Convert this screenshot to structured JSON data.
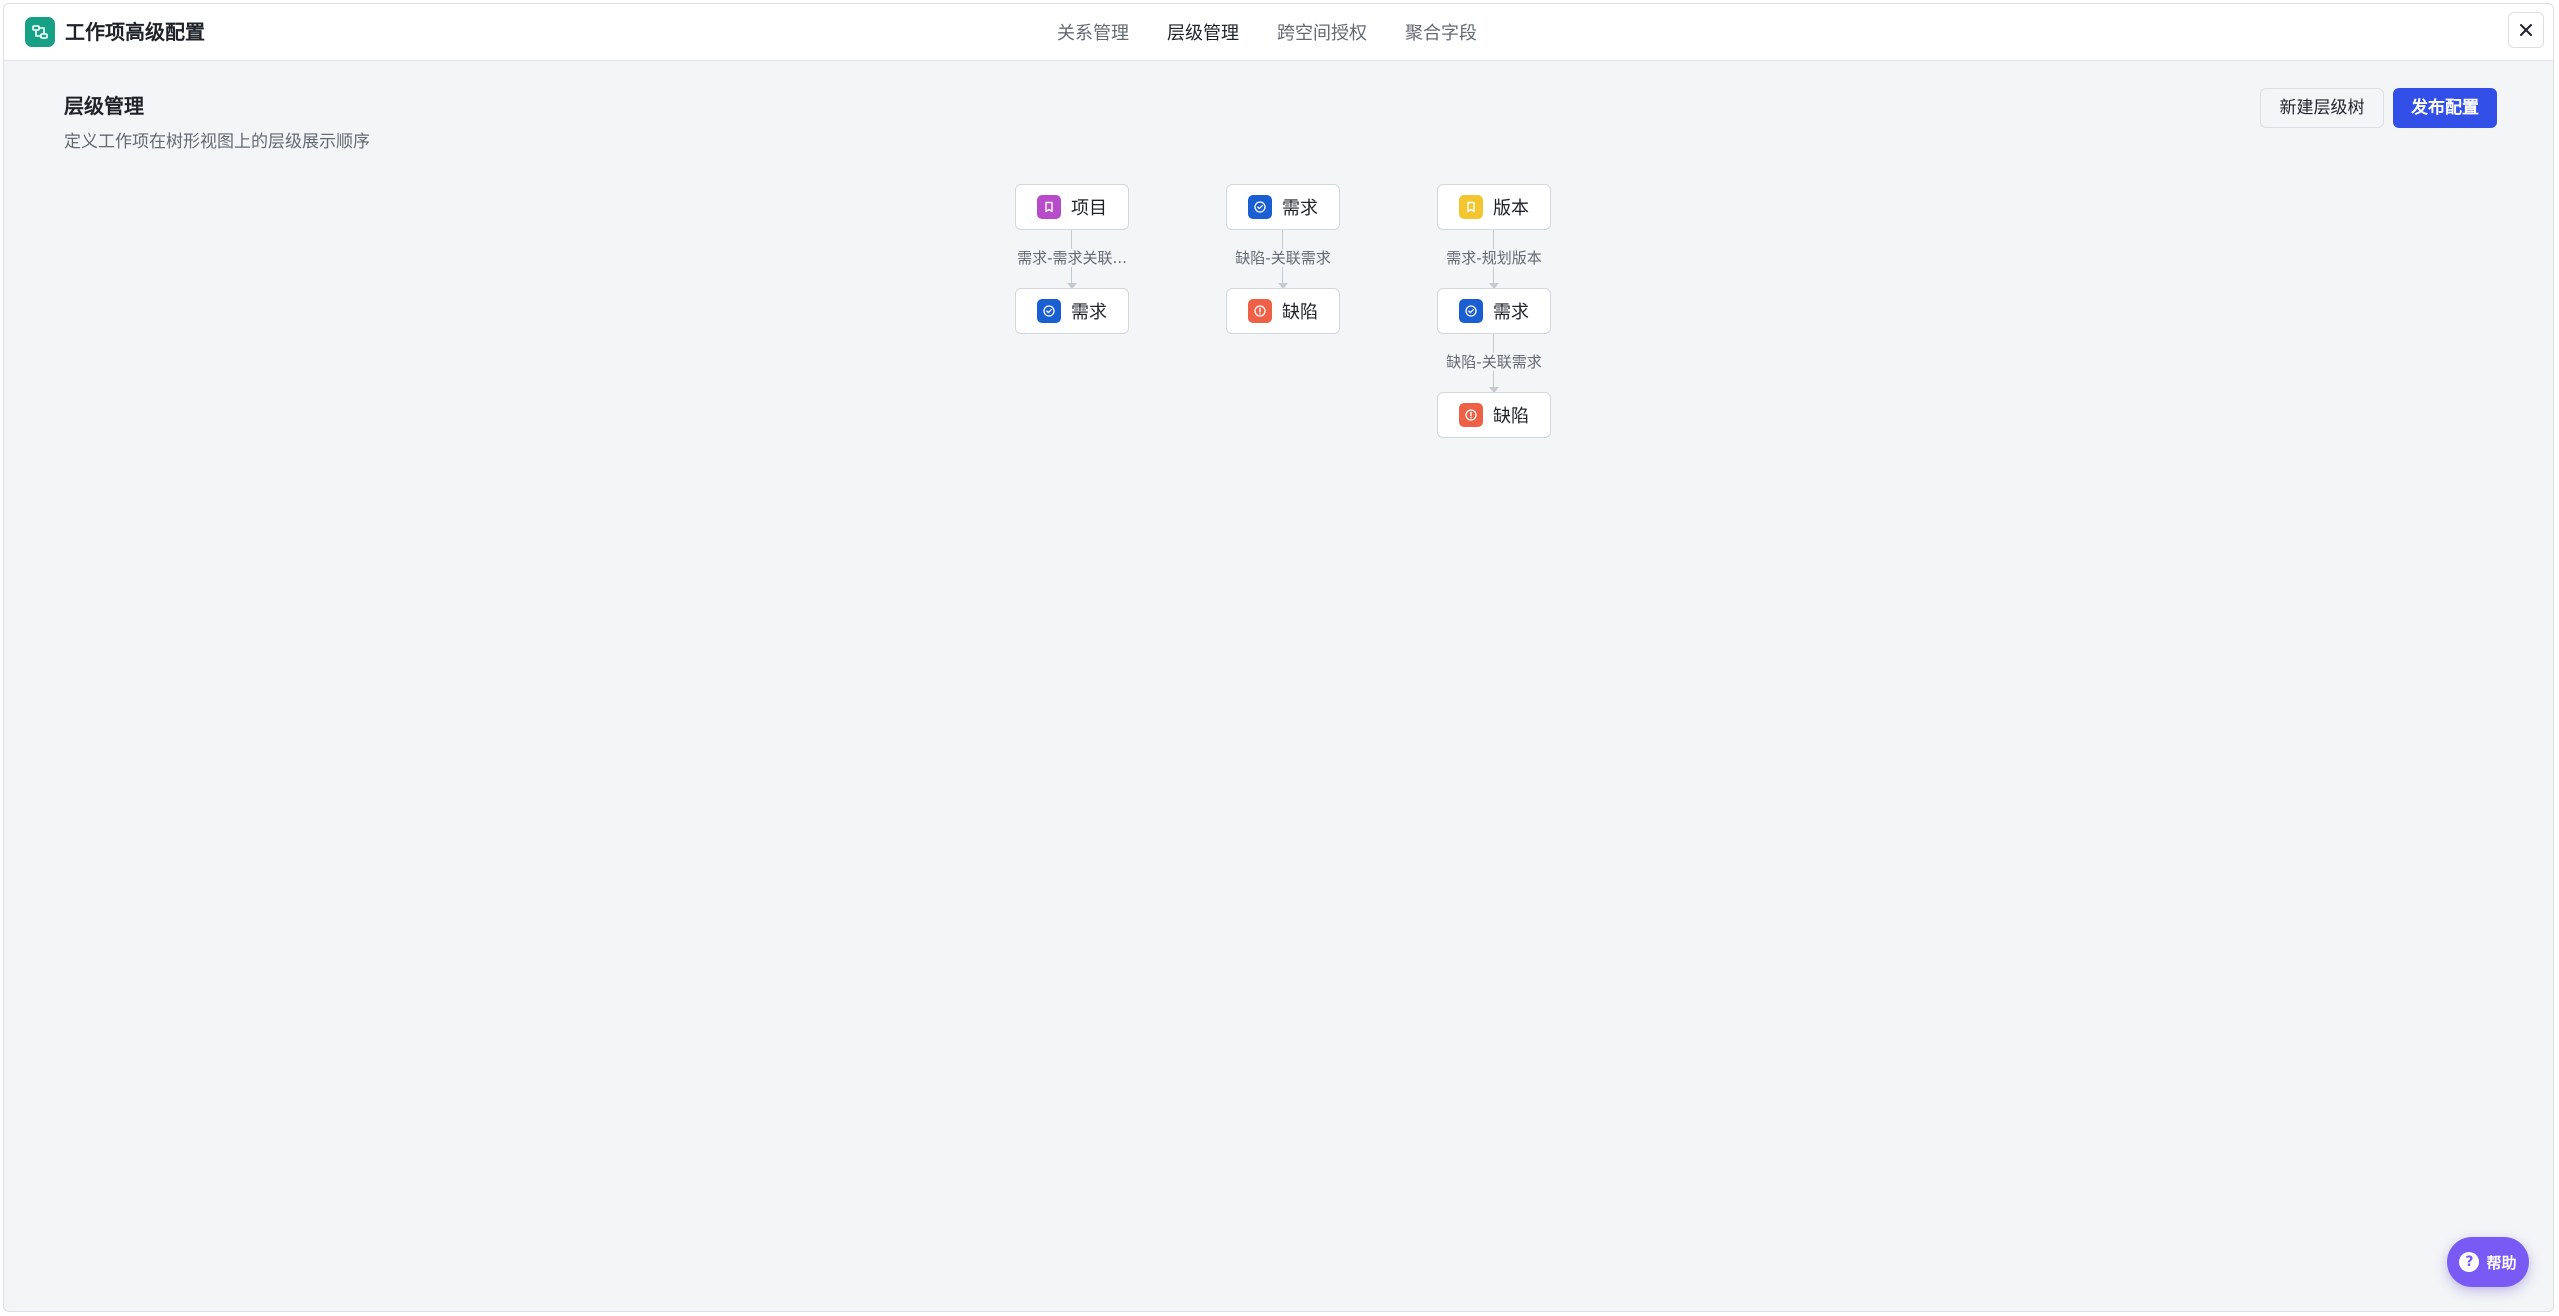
{
  "app": {
    "title": "工作项高级配置",
    "logo_icon": "workflow-icon",
    "close_icon": "close-icon"
  },
  "tabs": [
    {
      "label": "关系管理",
      "active": false
    },
    {
      "label": "层级管理",
      "active": true
    },
    {
      "label": "跨空间授权",
      "active": false
    },
    {
      "label": "聚合字段",
      "active": false
    }
  ],
  "section": {
    "title": "层级管理",
    "description": "定义工作项在树形视图上的层级展示顺序"
  },
  "actions": {
    "new_tree_label": "新建层级树",
    "publish_label": "发布配置"
  },
  "colors": {
    "accent": "#3250e8",
    "logo": "#16a085",
    "project": "#b84bc9",
    "requirement": "#1a5fd1",
    "defect": "#ef6146",
    "version": "#f3c52f",
    "help": "#7a5af5"
  },
  "trees": [
    {
      "nodes": [
        {
          "label": "项目",
          "type": "project",
          "icon": "bookmark-icon"
        },
        {
          "label": "需求",
          "type": "requirement",
          "icon": "check-circle-icon"
        }
      ],
      "relations": [
        "需求-需求关联..."
      ]
    },
    {
      "nodes": [
        {
          "label": "需求",
          "type": "requirement",
          "icon": "check-circle-icon"
        },
        {
          "label": "缺陷",
          "type": "defect",
          "icon": "alert-circle-icon"
        }
      ],
      "relations": [
        "缺陷-关联需求"
      ]
    },
    {
      "nodes": [
        {
          "label": "版本",
          "type": "version",
          "icon": "bookmark-icon"
        },
        {
          "label": "需求",
          "type": "requirement",
          "icon": "check-circle-icon"
        },
        {
          "label": "缺陷",
          "type": "defect",
          "icon": "alert-circle-icon"
        }
      ],
      "relations": [
        "需求-规划版本",
        "缺陷-关联需求"
      ]
    }
  ],
  "help": {
    "label": "帮助",
    "icon": "question-icon"
  }
}
